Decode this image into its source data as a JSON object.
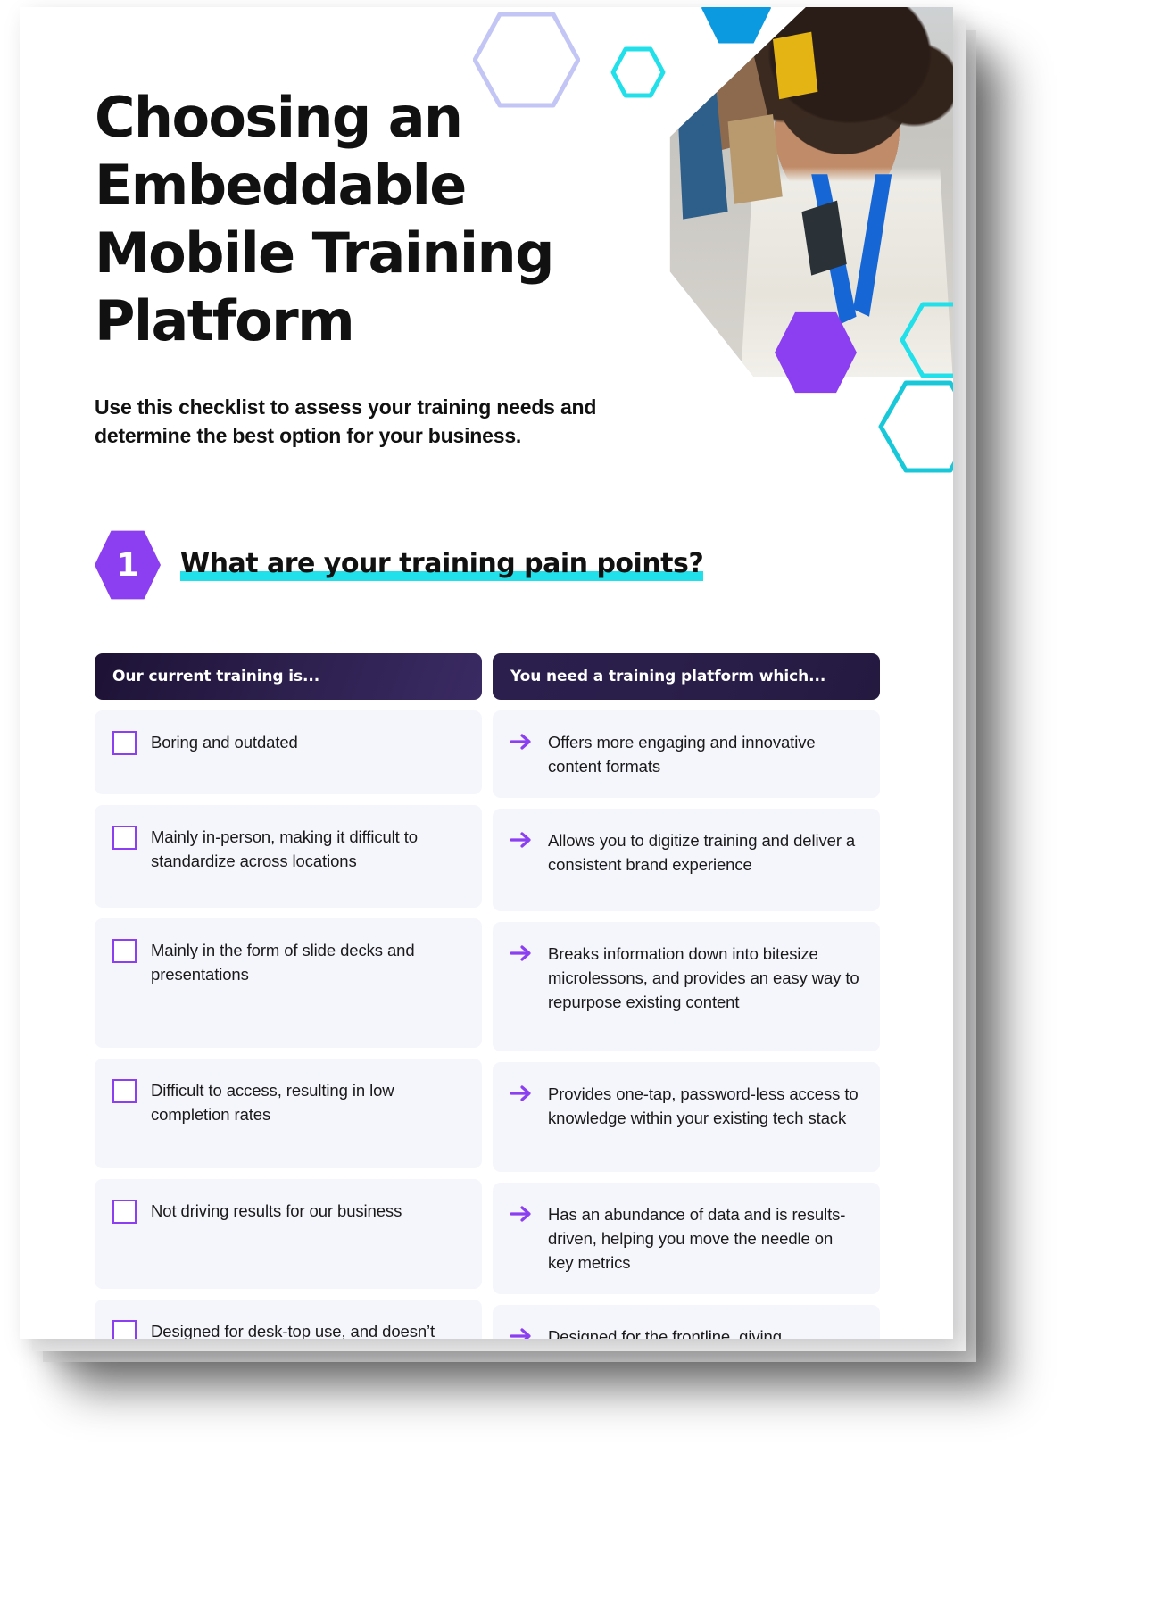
{
  "document": {
    "title": "Choosing an Embeddable Mobile Training Platform",
    "subtitle": "Use this checklist to assess your training needs and determine the best option for your business."
  },
  "section": {
    "number": "1",
    "heading": "What are your training pain points?"
  },
  "columns": {
    "left_header": "Our current training is...",
    "right_header": "You need a training platform which..."
  },
  "rows": [
    {
      "problem": "Boring and outdated",
      "solution": "Offers more engaging and innovative content formats"
    },
    {
      "problem": "Mainly in-person, making it difficult to standardize across locations",
      "solution": "Allows you to digitize training and deliver a consistent brand experience"
    },
    {
      "problem": "Mainly in the form of slide decks and presentations",
      "solution": "Breaks information down into bitesize microlessons, and provides an easy way to repurpose existing content"
    },
    {
      "problem": "Difficult to access, resulting in low completion rates",
      "solution": "Provides one-tap, password-less access to knowledge within your existing tech stack"
    },
    {
      "problem": "Not driving results for our business",
      "solution": "Has an abundance of data and is results-driven, helping you move the needle on key metrics"
    },
    {
      "problem": "Designed for desk-top use, and doesn’t take frontline workers’ needs into account",
      "solution": "Designed for the frontline, giving colleagues seamless access to mobile-first content"
    }
  ],
  "colors": {
    "purple": "#8b3ff0",
    "cyan": "#22e0ea",
    "blue": "#0b9ae0",
    "periwinkle": "#c3c6f5",
    "header_dark": "#2a1f4a",
    "cell_bg": "#f5f5fc"
  },
  "icons": {
    "checkbox": "checkbox-icon",
    "arrow": "arrow-right-icon",
    "hexagon": "hexagon-icon"
  }
}
